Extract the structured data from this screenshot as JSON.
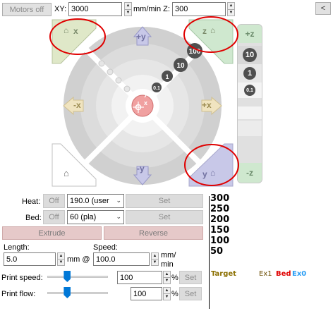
{
  "toolbar": {
    "motors_off_label": "Motors off",
    "xy_label": "XY:",
    "xy_value": "3000",
    "xy_unit": "mm/min",
    "z_label": "Z:",
    "z_value": "300",
    "collapse_label": "<"
  },
  "jog": {
    "home_x_label": "x",
    "home_y_label": "y",
    "home_z_label": "z",
    "minus_x_label": "-x",
    "plus_x_label": "+x",
    "plus_y_label": "+y",
    "minus_y_label": "-y",
    "step_100": "100",
    "step_10": "10",
    "step_1": "1",
    "step_01": "0.1",
    "center_x": "x",
    "center_y": "y"
  },
  "zcolumn": {
    "plus_z_label": "+z",
    "minus_z_label": "-z",
    "step_10": "10",
    "step_1": "1",
    "step_01": "0.1"
  },
  "temps": {
    "heat_label": "Heat:",
    "heat_off": "Off",
    "heat_value": "190.0 (user",
    "heat_set": "Set",
    "bed_label": "Bed:",
    "bed_off": "Off",
    "bed_value": "60 (pla)",
    "bed_set": "Set"
  },
  "extrusion": {
    "extrude_label": "Extrude",
    "reverse_label": "Reverse",
    "length_label": "Length:",
    "length_value": "5.0",
    "length_unit": "mm @",
    "speed_label": "Speed:",
    "speed_value": "100.0",
    "speed_unit_line1": "mm/",
    "speed_unit_line2": "min"
  },
  "print_controls": {
    "speed_label": "Print speed:",
    "speed_value": "100",
    "speed_fraction": 0.33,
    "speed_percent": "%",
    "speed_set": "Set",
    "flow_label": "Print flow:",
    "flow_value": "100",
    "flow_fraction": 0.33,
    "flow_percent": "%",
    "flow_set": "Set"
  },
  "graph": {
    "y_ticks": [
      "300",
      "250",
      "200",
      "150",
      "100",
      "50"
    ],
    "legend_target": "Target",
    "legend_ex1": "Ex1",
    "legend_bed": "Bed",
    "legend_ex0": "Ex0",
    "colors": {
      "target": "#8b6f00",
      "ex1": "#6b4c00",
      "bed": "#e00000",
      "ex0": "#2a9df4"
    }
  },
  "colors": {
    "home_xy": "#dfe8c8",
    "home_z": "#cfe8cf",
    "x_axis": "#f0e4c0",
    "y_axis": "#c8c8e8",
    "center": "#f0a0a0",
    "annotation_circle": "#e00000"
  }
}
